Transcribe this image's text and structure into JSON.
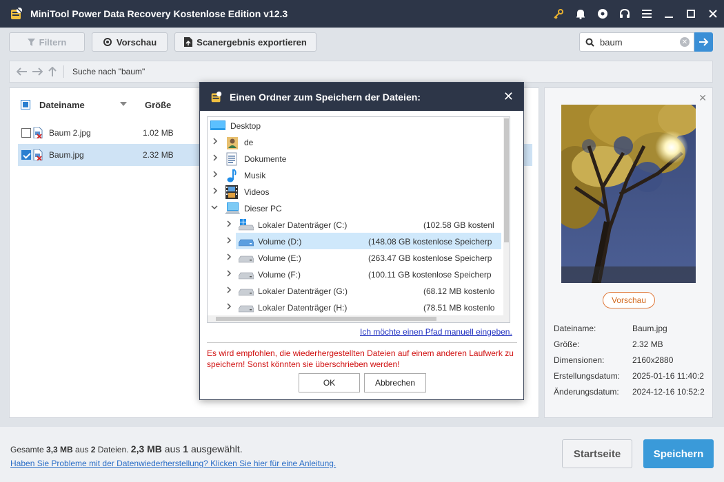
{
  "app": {
    "title": "MiniTool Power Data Recovery Kostenlose Edition v12.3",
    "icons": [
      "key-icon",
      "bell-icon",
      "disc-icon",
      "headset-icon",
      "menu-icon",
      "minimize-icon",
      "maximize-icon",
      "close-icon"
    ],
    "accent": "#3a9ad9",
    "titlebar_color": "#2d3648"
  },
  "toolbar": {
    "filter_label": "Filtern",
    "preview_label": "Vorschau",
    "export_label": "Scanergebnis exportieren",
    "search_value": "baum"
  },
  "nav": {
    "path": "Suche nach \"baum\""
  },
  "files": {
    "headers": {
      "name": "Dateiname",
      "size": "Größe"
    },
    "rows": [
      {
        "name": "Baum 2.jpg",
        "size": "1.02 MB",
        "checked": false
      },
      {
        "name": "Baum.jpg",
        "size": "2.32 MB",
        "checked": true
      }
    ]
  },
  "preview": {
    "button": "Vorschau",
    "labels": [
      "Dateiname:",
      "Größe:",
      "Dimensionen:",
      "Erstellungsdatum:",
      "Änderungsdatum:"
    ],
    "values": [
      "Baum.jpg",
      "2.32 MB",
      "2160x2880",
      "2025-01-16 11:40:2",
      "2024-12-16 10:52:2"
    ]
  },
  "bottom": {
    "summary_prefix": "Gesamte ",
    "summary_total": "3,3 MB",
    "summary_mid1": " aus ",
    "summary_count": "2",
    "summary_mid2": " Dateien.",
    "summary_selected": "2,3 MB",
    "summary_mid3": " aus ",
    "summary_selcount": "1",
    "summary_end": " ausgewählt.",
    "help_link": "Haben Sie Probleme mit der Datenwiederherstellung? Klicken Sie hier für eine Anleitung.",
    "home_button": "Startseite",
    "save_button": "Speichern"
  },
  "dialog": {
    "title": "Einen Ordner zum Speichern der Dateien:",
    "tree": [
      {
        "label": "Desktop",
        "info": ""
      },
      {
        "label": "de",
        "info": ""
      },
      {
        "label": "Dokumente",
        "info": ""
      },
      {
        "label": "Musik",
        "info": ""
      },
      {
        "label": "Videos",
        "info": ""
      },
      {
        "label": "Dieser PC",
        "info": ""
      },
      {
        "label": "Lokaler Datenträger (C:)",
        "info": "(102.58 GB kostenl"
      },
      {
        "label": "Volume (D:)",
        "info": "(148.08 GB kostenlose Speicherp"
      },
      {
        "label": "Volume (E:)",
        "info": "(263.47 GB kostenlose Speicherp"
      },
      {
        "label": "Volume (F:)",
        "info": "(100.11 GB kostenlose Speicherp"
      },
      {
        "label": "Lokaler Datenträger (G:)",
        "info": "(68.12 MB kostenlo"
      },
      {
        "label": "Lokaler Datenträger (H:)",
        "info": "(78.51 MB kostenlo"
      }
    ],
    "manual_link": "Ich möchte einen Pfad manuell eingeben.",
    "warning": "Es wird empfohlen, die wiederhergestellten Dateien auf einem anderen Laufwerk zu speichern! Sonst könnten sie überschrieben werden!",
    "ok_label": "OK",
    "cancel_label": "Abbrechen"
  }
}
